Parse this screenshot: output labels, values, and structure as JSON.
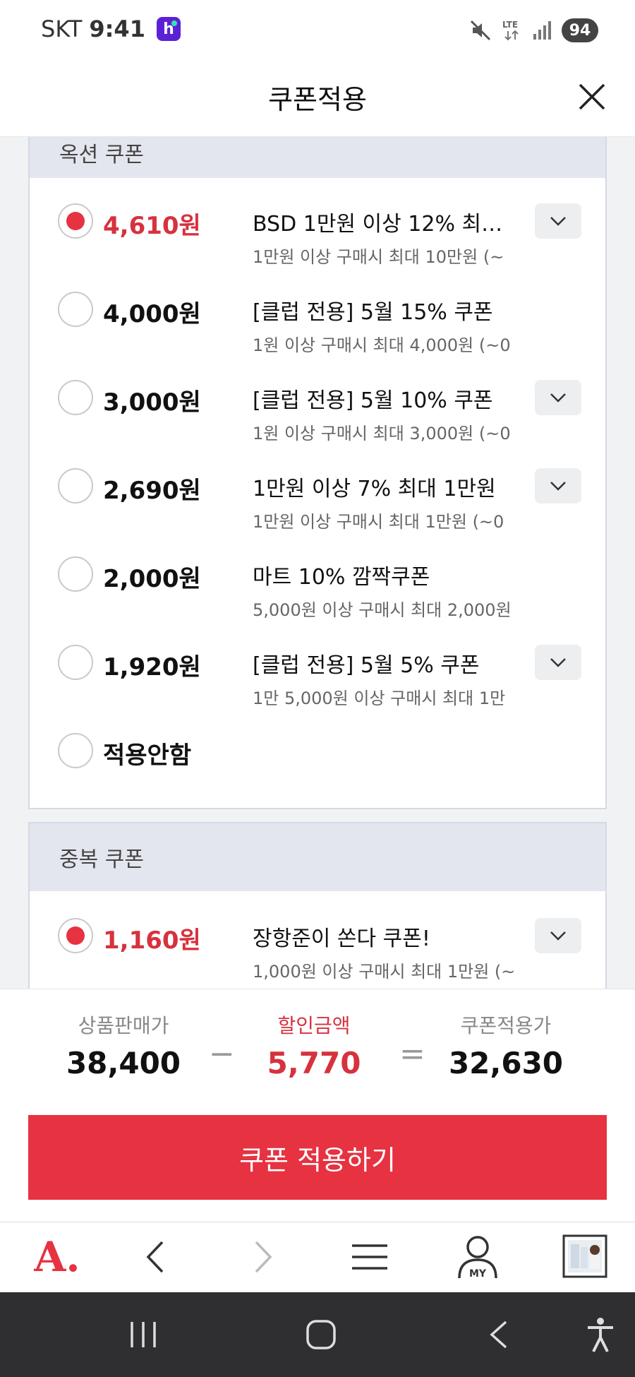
{
  "status_bar": {
    "carrier": "SKT",
    "time": "9:41",
    "app_badge": "h",
    "network": "LTE",
    "battery": "94"
  },
  "header": {
    "title": "쿠폰적용",
    "close_icon": "close-icon"
  },
  "option_coupons": {
    "section_title": "옥션 쿠폰",
    "items": [
      {
        "amount": "4,610원",
        "title": "BSD 1만원 이상 12% 최대 1...",
        "desc": "1만원 이상 구매시 최대 10만원 (~",
        "selected": true,
        "has_detail": true
      },
      {
        "amount": "4,000원",
        "title": "[클럽 전용] 5월 15% 쿠폰",
        "desc": "1원 이상 구매시 최대 4,000원 (~0",
        "selected": false,
        "has_detail": false
      },
      {
        "amount": "3,000원",
        "title": "[클럽 전용] 5월 10% 쿠폰",
        "desc": "1원 이상 구매시 최대 3,000원 (~0",
        "selected": false,
        "has_detail": true
      },
      {
        "amount": "2,690원",
        "title": "1만원 이상 7% 최대 1만원",
        "desc": "1만원 이상 구매시 최대 1만원 (~0",
        "selected": false,
        "has_detail": true
      },
      {
        "amount": "2,000원",
        "title": "마트 10% 깜짝쿠폰",
        "desc": "5,000원 이상 구매시 최대 2,000원",
        "selected": false,
        "has_detail": false
      },
      {
        "amount": "1,920원",
        "title": "[클럽 전용] 5월 5% 쿠폰",
        "desc": "1만 5,000원 이상 구매시 최대 1만",
        "selected": false,
        "has_detail": true
      },
      {
        "amount": "적용안함",
        "title": "",
        "desc": "",
        "selected": false,
        "has_detail": false
      }
    ]
  },
  "duplicate_coupons": {
    "section_title": "중복 쿠폰",
    "items": [
      {
        "amount": "1,160원",
        "title": "장항준이 쏜다 쿠폰!",
        "desc": "1,000원 이상 구매시 최대 1만원 (~",
        "selected": true,
        "has_detail": true
      }
    ]
  },
  "summary": {
    "price_label": "상품판매가",
    "price_value": "38,400",
    "minus": "−",
    "discount_label": "할인금액",
    "discount_value": "5,770",
    "equals": "=",
    "final_label": "쿠폰적용가",
    "final_value": "32,630",
    "apply_button": "쿠폰 적용하기"
  },
  "browser_bar": {
    "logo": "A.",
    "my_label": "MY"
  },
  "colors": {
    "accent": "#e63241",
    "selected_amount": "#d6323e",
    "section_header_bg": "#e3e6ee"
  }
}
